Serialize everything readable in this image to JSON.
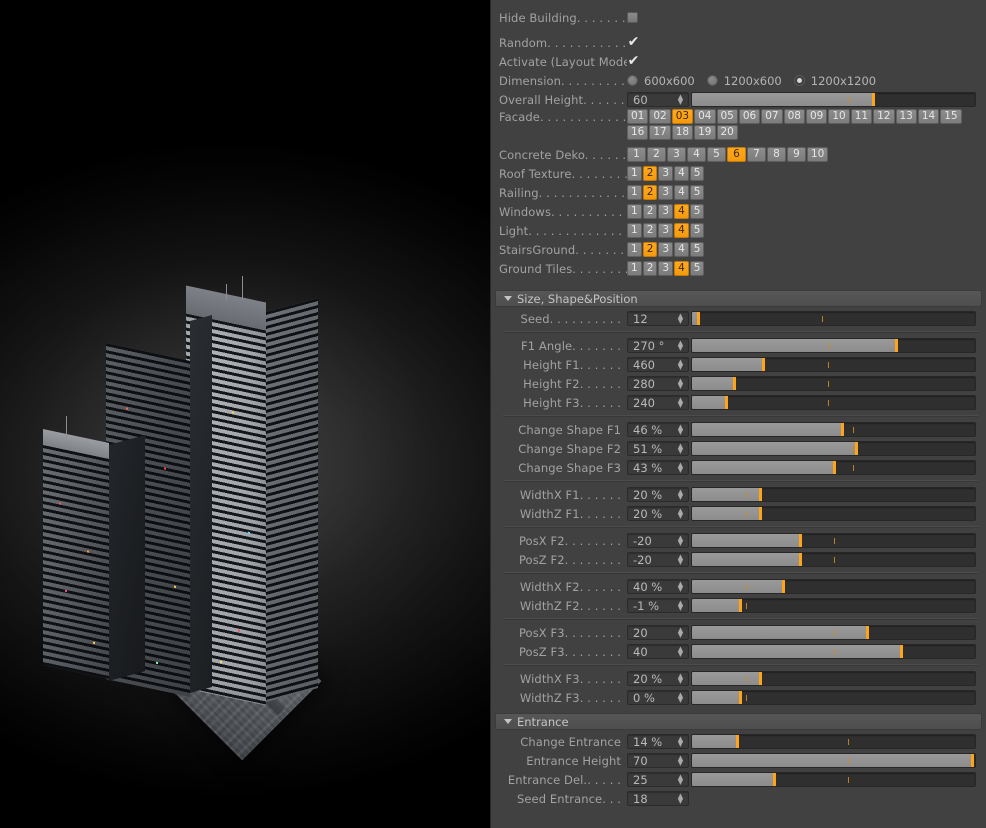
{
  "viewport": {
    "name": "3d-render-viewport",
    "description": "Dark 3D viewport showing a procedurally generated group of skyscrapers standing on a textured city block ground plane"
  },
  "panel": {
    "top_group": {
      "hide_building": {
        "label": "Hide Building",
        "dots": ". . . . . . . .",
        "checked": false
      },
      "random": {
        "label": "Random",
        "dots": ". . . . . . . . . . . .",
        "checked": true
      },
      "activate": {
        "label": "Activate (Layout Mode)",
        "dots": "",
        "checked": true
      },
      "dimension": {
        "label": "Dimension",
        "dots": ". . . . . . . . . . .",
        "options": [
          "600x600",
          "1200x600",
          "1200x1200"
        ],
        "selected": "1200x1200"
      },
      "overall_height": {
        "label": "Overall Height",
        "dots": ". . . . . . . .",
        "value": "60",
        "fill_pct": 64,
        "mid_pct": 55
      },
      "facade": {
        "label": "Facade",
        "dots": ". . . . . . . . . . . . .",
        "buttons": [
          "01",
          "02",
          "03",
          "04",
          "05",
          "06",
          "07",
          "08",
          "09",
          "10",
          "11",
          "12",
          "13",
          "14",
          "15",
          "16",
          "17",
          "18",
          "19",
          "20"
        ],
        "selected": "03"
      },
      "concrete_deko": {
        "label": "Concrete Deko",
        "dots": ". . . . . . . .",
        "buttons": [
          "1",
          "2",
          "3",
          "4",
          "5",
          "6",
          "7",
          "8",
          "9",
          "10"
        ],
        "selected": "6"
      },
      "roof_texture": {
        "label": "Roof Texture",
        "dots": ". . . . . . . . .",
        "buttons": [
          "1",
          "2",
          "3",
          "4",
          "5"
        ],
        "selected": "2"
      },
      "railing": {
        "label": "Railing",
        "dots": ". . . . . . . . . . . . .",
        "buttons": [
          "1",
          "2",
          "3",
          "4",
          "5"
        ],
        "selected": "2"
      },
      "windows": {
        "label": "Windows",
        "dots": ". . . . . . . . . . .",
        "buttons": [
          "1",
          "2",
          "3",
          "4",
          "5"
        ],
        "selected": "4"
      },
      "light": {
        "label": "Light",
        "dots": ". . . . . . . . . . . . . .",
        "buttons": [
          "1",
          "2",
          "3",
          "4",
          "5"
        ],
        "selected": "4"
      },
      "stairs_ground": {
        "label": "StairsGround",
        "dots": ". . . . . . . .",
        "buttons": [
          "1",
          "2",
          "3",
          "4",
          "5"
        ],
        "selected": "2"
      },
      "ground_tiles": {
        "label": "Ground Tiles",
        "dots": ". . . . . . . .",
        "buttons": [
          "1",
          "2",
          "3",
          "4",
          "5"
        ],
        "selected": "4"
      }
    },
    "size_shape_position": {
      "title": "Size, Shape&Position",
      "rows": [
        {
          "label": "Seed",
          "dots": ". . . . . . . . . .",
          "value": "12",
          "fill_pct": 2,
          "mid_pct": 46
        },
        {
          "label": "F1 Angle",
          "dots": ". . . . . . .",
          "value": "270 °",
          "fill_pct": 72,
          "mid_pct": 48
        },
        {
          "label": "Height F1",
          "dots": ". . . . . .",
          "value": "460",
          "fill_pct": 25,
          "mid_pct": 48
        },
        {
          "label": "Height F2",
          "dots": ". . . . . .",
          "value": "280",
          "fill_pct": 15,
          "mid_pct": 48
        },
        {
          "label": "Height F3",
          "dots": ". . . . . .",
          "value": "240",
          "fill_pct": 12,
          "mid_pct": 48
        },
        {
          "label": "Change Shape F1",
          "dots": "",
          "value": "46 %",
          "fill_pct": 53,
          "mid_pct": 57
        },
        {
          "label": "Change Shape F2",
          "dots": "",
          "value": "51 %",
          "fill_pct": 58,
          "mid_pct": 57
        },
        {
          "label": "Change Shape F3",
          "dots": "",
          "value": "43 %",
          "fill_pct": 50,
          "mid_pct": 57
        },
        {
          "label": "WidthX F1",
          "dots": ". . . . . .",
          "value": "20 %",
          "fill_pct": 24,
          "mid_pct": 19
        },
        {
          "label": "WidthZ F1",
          "dots": ". . . . . .",
          "value": "20 %",
          "fill_pct": 24,
          "mid_pct": 19
        },
        {
          "label": "PosX F2",
          "dots": ". . . . . . . .",
          "value": "-20",
          "fill_pct": 38,
          "mid_pct": 50
        },
        {
          "label": "PosZ F2",
          "dots": ". . . . . . . .",
          "value": "-20",
          "fill_pct": 38,
          "mid_pct": 50
        },
        {
          "label": "WidthX F2",
          "dots": ". . . . . .",
          "value": "40 %",
          "fill_pct": 32,
          "mid_pct": 19
        },
        {
          "label": "WidthZ F2",
          "dots": ". . . . . .",
          "value": "-1 %",
          "fill_pct": 17,
          "mid_pct": 19
        },
        {
          "label": "PosX F3",
          "dots": ". . . . . . . .",
          "value": "20",
          "fill_pct": 62,
          "mid_pct": 50
        },
        {
          "label": "PosZ F3",
          "dots": ". . . . . . . .",
          "value": "40",
          "fill_pct": 74,
          "mid_pct": 50
        },
        {
          "label": "WidthX F3",
          "dots": ". . . . . .",
          "value": "20 %",
          "fill_pct": 24,
          "mid_pct": 19
        },
        {
          "label": "WidthZ F3",
          "dots": ". . . . . .",
          "value": "0 %",
          "fill_pct": 17,
          "mid_pct": 19
        }
      ]
    },
    "entrance": {
      "title": "Entrance",
      "rows": [
        {
          "label": "Change Entrance",
          "dots": "",
          "value": "14 %",
          "fill_pct": 16,
          "mid_pct": 55,
          "has_slider": true
        },
        {
          "label": "Entrance Height",
          "dots": "",
          "value": "70",
          "fill_pct": 99,
          "mid_pct": 55,
          "has_slider": true
        },
        {
          "label": "Entrance Del.",
          "dots": ". . . . .",
          "value": "25",
          "fill_pct": 29,
          "mid_pct": 55,
          "has_slider": true
        },
        {
          "label": "Seed Entrance",
          "dots": ". . .",
          "value": "18",
          "fill_pct": 0,
          "mid_pct": 0,
          "has_slider": false
        }
      ]
    }
  },
  "colors": {
    "panel_bg": "#414141",
    "accent_orange": "#ffa317",
    "button_gray": "#8c8c8c",
    "slider_fill": "#949494",
    "slider_track": "#2f2f2f",
    "label_text": "#a2a2a2"
  }
}
